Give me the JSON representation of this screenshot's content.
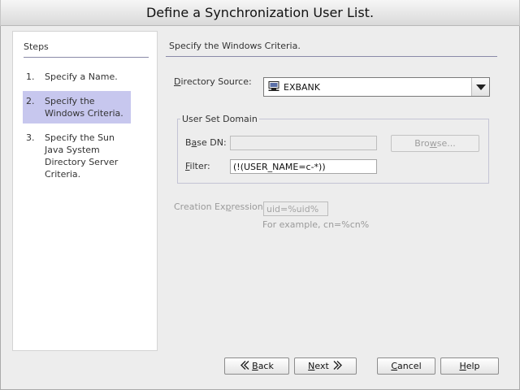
{
  "window": {
    "title": "Define a Synchronization User List."
  },
  "steps": {
    "title": "Steps",
    "items": [
      {
        "num": "1.",
        "lines": [
          "Specify a Name."
        ]
      },
      {
        "num": "2.",
        "lines": [
          "Specify the",
          "Windows Criteria."
        ],
        "active": true
      },
      {
        "num": "3.",
        "lines": [
          "Specify the Sun",
          "Java System",
          "Directory Server",
          "Criteria."
        ]
      }
    ]
  },
  "main": {
    "heading": "Specify the Windows Criteria.",
    "directory_source": {
      "label_pre": "",
      "label_mn": "D",
      "label_post": "irectory Source:",
      "value": "EXBANK",
      "icon": "computer-icon"
    },
    "user_set_domain": {
      "title": "User Set Domain",
      "base_dn": {
        "label_pre": "B",
        "label_mn": "a",
        "label_post": "se DN:",
        "value": ""
      },
      "filter": {
        "label_pre": "",
        "label_mn": "F",
        "label_post": "ilter:",
        "value": "(!(USER_NAME=c-*))"
      },
      "browse": {
        "label_pre": "Bro",
        "label_mn": "w",
        "label_post": "se..."
      }
    },
    "creation_expression": {
      "label_pre": "Creation Ex",
      "label_mn": "p",
      "label_post": "ression:",
      "value": "uid=%uid%",
      "example": "For example, cn=%cn%"
    }
  },
  "footer": {
    "back": {
      "mn": "B",
      "rest": "ack",
      "icon": "chevron-left-icon"
    },
    "next": {
      "mn": "N",
      "rest": "ext",
      "icon": "chevron-right-icon"
    },
    "cancel": {
      "mn": "C",
      "rest": "ancel"
    },
    "help": {
      "mn": "H",
      "rest": "elp"
    }
  }
}
